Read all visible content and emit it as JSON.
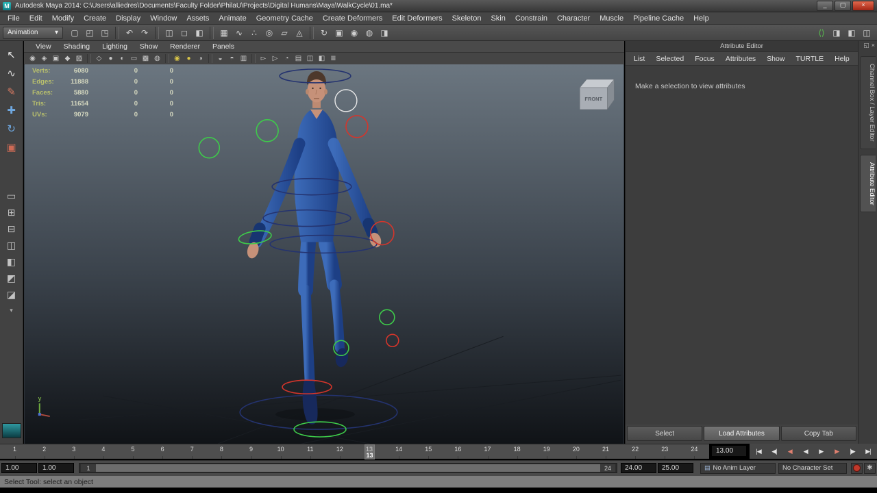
{
  "colors": {
    "viewport_top": "#6b7680",
    "viewport_mid": "#3b434c",
    "viewport_bottom": "#101317",
    "suit_blue": "#2a55a3",
    "suit_light": "#3d6cba",
    "suit_dark": "#1d3f85",
    "skin": "#c69179",
    "control_green": "#3ecb4a",
    "control_red": "#d5352b",
    "control_navy": "#24336f",
    "control_white": "#e9e9e9",
    "autokey_red": "#c0392b",
    "hud_label": "#b9c06c",
    "hud_value": "#d6d9c0"
  },
  "title_bar": {
    "title": "Autodesk Maya 2014: C:\\Users\\alliedres\\Documents\\Faculty Folder\\PhilaU\\Projects\\Digital Humans\\Maya\\WalkCycle\\01.ma*",
    "window_buttons": [
      {
        "name": "minimize-button",
        "glyph": "_"
      },
      {
        "name": "maximize-button",
        "glyph": "▢"
      },
      {
        "name": "close-button",
        "glyph": "×"
      }
    ]
  },
  "menu_bar": {
    "items": [
      "File",
      "Edit",
      "Modify",
      "Create",
      "Display",
      "Window",
      "Assets",
      "Animate",
      "Geometry Cache",
      "Create Deformers",
      "Edit Deformers",
      "Skeleton",
      "Skin",
      "Constrain",
      "Character",
      "Muscle",
      "Pipeline Cache",
      "Help"
    ]
  },
  "toolbar": {
    "menu_set": "Animation",
    "icon_groups": [
      [
        {
          "name": "new-scene-icon",
          "glyph": "▢"
        },
        {
          "name": "open-scene-icon",
          "glyph": "◰"
        },
        {
          "name": "save-scene-icon",
          "glyph": "◳"
        }
      ],
      [
        {
          "name": "undo-icon",
          "glyph": "↶"
        },
        {
          "name": "redo-icon",
          "glyph": "↷"
        }
      ],
      [
        {
          "name": "select-by-hierarchy-icon",
          "glyph": "◫"
        },
        {
          "name": "select-by-object-icon",
          "glyph": "◻"
        },
        {
          "name": "select-by-component-icon",
          "glyph": "◧"
        }
      ],
      [
        {
          "name": "snap-to-grids-icon",
          "glyph": "▦"
        },
        {
          "name": "snap-to-curves-icon",
          "glyph": "∿"
        },
        {
          "name": "snap-to-points-icon",
          "glyph": "∴"
        },
        {
          "name": "snap-to-projected-center-icon",
          "glyph": "◎"
        },
        {
          "name": "snap-to-view-planes-icon",
          "glyph": "▱"
        },
        {
          "name": "make-live-icon",
          "glyph": "◬"
        }
      ],
      [
        {
          "name": "construction-history-icon",
          "glyph": "↻"
        },
        {
          "name": "open-render-view-icon",
          "glyph": "▣"
        },
        {
          "name": "render-current-frame-icon",
          "glyph": "◉"
        },
        {
          "name": "ipr-render-icon",
          "glyph": "◍"
        },
        {
          "name": "render-settings-icon",
          "glyph": "◨"
        }
      ]
    ],
    "right_icons": [
      {
        "name": "modeling-toolkit-icon",
        "glyph": "⟨⟩",
        "color": "#58c24e"
      },
      {
        "name": "toggle-attribute-editor-icon",
        "glyph": "◨"
      },
      {
        "name": "toggle-tool-settings-icon",
        "glyph": "◧"
      },
      {
        "name": "toggle-channel-box-icon",
        "glyph": "◫"
      }
    ]
  },
  "toolbox": {
    "tools": [
      {
        "name": "select-tool-icon",
        "glyph": "↖",
        "color": "#ececec"
      },
      {
        "name": "lasso-tool-icon",
        "glyph": "∿",
        "color": "#d8d8d8"
      },
      {
        "name": "paint-selection-tool-icon",
        "glyph": "✎",
        "color": "#d87a62"
      },
      {
        "name": "move-tool-icon",
        "glyph": "✚",
        "color": "#6fa8e0"
      },
      {
        "name": "rotate-tool-icon",
        "glyph": "↻",
        "color": "#6fa8e0"
      },
      {
        "name": "scale-tool-icon",
        "glyph": "▣",
        "color": "#cd6a55"
      }
    ],
    "layouts": [
      {
        "name": "single-pane-layout-icon",
        "glyph": "▭"
      },
      {
        "name": "four-pane-layout-icon",
        "glyph": "⊞"
      },
      {
        "name": "two-pane-stacked-layout-icon",
        "glyph": "⊟"
      },
      {
        "name": "two-pane-side-layout-icon",
        "glyph": "◫"
      },
      {
        "name": "three-pane-left-layout-icon",
        "glyph": "◧"
      },
      {
        "name": "three-pane-bottom-layout-icon",
        "glyph": "◩"
      },
      {
        "name": "outliner-persp-layout-icon",
        "glyph": "◪"
      }
    ]
  },
  "viewport": {
    "panel_menu": [
      "View",
      "Shading",
      "Lighting",
      "Show",
      "Renderer",
      "Panels"
    ],
    "toolbar_icons": [
      {
        "name": "select-camera-icon",
        "glyph": "◉"
      },
      {
        "name": "lock-camera-icon",
        "glyph": "◈"
      },
      {
        "name": "camera-attributes-icon",
        "glyph": "▣"
      },
      {
        "name": "bookmarks-icon",
        "glyph": "◆"
      },
      {
        "name": "image-plane-icon",
        "glyph": "▨"
      },
      {
        "name": "separator"
      },
      {
        "name": "wireframe-mode-icon",
        "glyph": "◇"
      },
      {
        "name": "smooth-shade-icon",
        "glyph": "●"
      },
      {
        "name": "flat-shade-icon",
        "glyph": "◐"
      },
      {
        "name": "bounding-box-icon",
        "glyph": "▭"
      },
      {
        "name": "textured-mode-icon",
        "glyph": "▩"
      },
      {
        "name": "use-default-material-icon",
        "glyph": "◍"
      },
      {
        "name": "separator"
      },
      {
        "name": "lighting-all-icon",
        "glyph": "◉",
        "color": "#d9c548"
      },
      {
        "name": "lighting-default-icon",
        "glyph": "●",
        "color": "#d9c548"
      },
      {
        "name": "shadows-icon",
        "glyph": "◑"
      },
      {
        "name": "separator"
      },
      {
        "name": "screen-space-ao-icon",
        "glyph": "◒"
      },
      {
        "name": "motion-blur-icon",
        "glyph": "◓"
      },
      {
        "name": "multisample-aa-icon",
        "glyph": "▥"
      },
      {
        "name": "separator"
      },
      {
        "name": "xray-icon",
        "glyph": "▻"
      },
      {
        "name": "xray-joints-icon",
        "glyph": "▷"
      },
      {
        "name": "isolate-select-icon",
        "glyph": "◔"
      },
      {
        "name": "field-chart-icon",
        "glyph": "▤"
      },
      {
        "name": "resolution-gate-icon",
        "glyph": "◫"
      },
      {
        "name": "gate-mask-icon",
        "glyph": "◧"
      },
      {
        "name": "hud-toggle-icon",
        "glyph": "≣"
      }
    ],
    "hud": {
      "rows": [
        {
          "label": "Verts:",
          "value": "6080",
          "c1": "0",
          "c2": "0"
        },
        {
          "label": "Edges:",
          "value": "11888",
          "c1": "0",
          "c2": "0"
        },
        {
          "label": "Faces:",
          "value": "5880",
          "c1": "0",
          "c2": "0"
        },
        {
          "label": "Tris:",
          "value": "11654",
          "c1": "0",
          "c2": "0"
        },
        {
          "label": "UVs:",
          "value": "9079",
          "c1": "0",
          "c2": "0"
        }
      ]
    },
    "view_cube_label": "FRONT",
    "axis_label": "y"
  },
  "attribute_editor": {
    "title": "Attribute Editor",
    "menu": [
      "List",
      "Selected",
      "Focus",
      "Attributes",
      "Show",
      "TURTLE",
      "Help"
    ],
    "message": "Make a selection to view attributes",
    "buttons": [
      "Select",
      "Load Attributes",
      "Copy Tab"
    ]
  },
  "side_strip": {
    "header_icons": [
      {
        "name": "pop-out-panel-icon",
        "glyph": "◱"
      },
      {
        "name": "close-panel-icon",
        "glyph": "×"
      }
    ],
    "tabs": [
      "Channel Box / Layer Editor",
      "Attribute Editor"
    ]
  },
  "timeline": {
    "frames": [
      "1",
      "2",
      "3",
      "4",
      "5",
      "6",
      "7",
      "8",
      "9",
      "10",
      "11",
      "12",
      "13",
      "14",
      "15",
      "16",
      "17",
      "18",
      "19",
      "20",
      "21",
      "22",
      "23",
      "24"
    ],
    "current_frame": "13",
    "current_frame_field": "13.00"
  },
  "playback": {
    "buttons": [
      {
        "name": "go-to-playback-start-button",
        "glyph": "|◀"
      },
      {
        "name": "step-back-one-frame-button",
        "glyph": "◀|"
      },
      {
        "name": "step-back-one-key-button",
        "glyph": "◀",
        "color": "#e08070"
      },
      {
        "name": "play-backwards-button",
        "glyph": "◀"
      },
      {
        "name": "play-forwards-button",
        "glyph": "▶"
      },
      {
        "name": "step-forward-one-key-button",
        "glyph": "▶",
        "color": "#e08070"
      },
      {
        "name": "step-forward-one-frame-button",
        "glyph": "|▶"
      },
      {
        "name": "go-to-playback-end-button",
        "glyph": "▶|"
      }
    ]
  },
  "range_slider": {
    "animation_start": "1.00",
    "playback_start": "1.00",
    "range_start": "1",
    "range_end": "24",
    "playback_end": "24.00",
    "animation_end": "25.00",
    "anim_layer": "No Anim Layer",
    "character_set": "No Character Set"
  },
  "help_line": {
    "text": "Select Tool: select an object"
  }
}
